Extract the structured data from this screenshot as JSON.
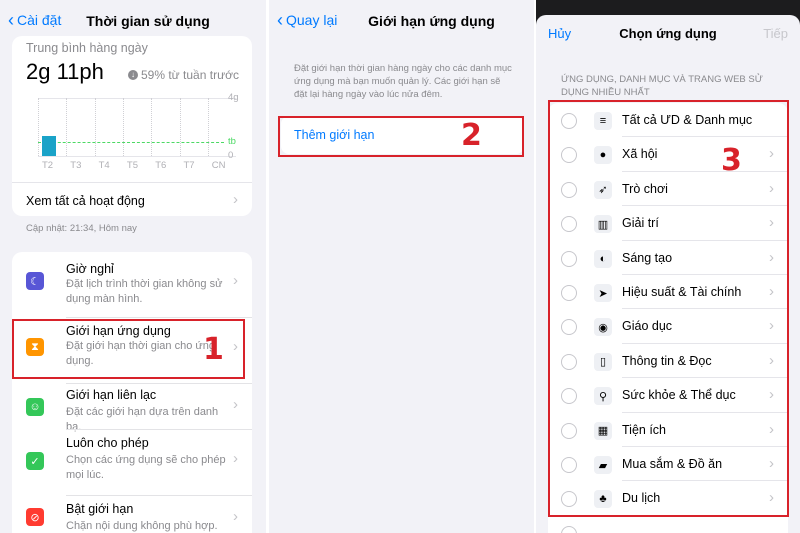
{
  "panel1": {
    "back_label": "Cài đặt",
    "title": "Thời gian sử dụng",
    "daily_avg_label": "Trung bình hàng ngày",
    "daily_avg_value": "2g 11ph",
    "change_label": "59% từ tuần trước",
    "chart_data": {
      "type": "bar",
      "categories": [
        "T2",
        "T3",
        "T4",
        "T5",
        "T6",
        "T7",
        "CN"
      ],
      "values": [
        1.35,
        0,
        0,
        0,
        0,
        0,
        0
      ],
      "average": 0.95,
      "average_label": "tb",
      "ylim": [
        0,
        4
      ],
      "y_ticks": [
        "4g",
        "0"
      ],
      "bar_color": "#1aa3c8",
      "average_color": "#4cd964"
    },
    "see_all_label": "Xem tất cả hoạt động",
    "updated_label": "Cập nhật: 21:34, Hôm nay",
    "items": [
      {
        "title": "Giờ nghỉ",
        "subtitle": "Đặt lịch trình thời gian không sử dụng màn hình.",
        "icon": "moon-icon",
        "color": "#5856d6"
      },
      {
        "title": "Giới hạn ứng dụng",
        "subtitle": "Đặt giới hạn thời gian cho ứng dụng.",
        "icon": "hourglass-icon",
        "color": "#ff9500"
      },
      {
        "title": "Giới hạn liên lạc",
        "subtitle": "Đặt các giới hạn dựa trên danh bạ.",
        "icon": "person-icon",
        "color": "#34c759"
      },
      {
        "title": "Luôn cho phép",
        "subtitle": "Chọn các ứng dụng sẽ cho phép mọi lúc.",
        "icon": "checkmark-icon",
        "color": "#34c759"
      },
      {
        "title": "Bật giới hạn",
        "subtitle": "Chặn nội dung không phù hợp.",
        "icon": "block-icon",
        "color": "#ff3b30"
      }
    ],
    "step": "1"
  },
  "panel2": {
    "back_label": "Quay lại",
    "title": "Giới hạn ứng dụng",
    "description": "Đặt giới hạn thời gian hàng ngày cho các danh mục ứng dụng mà bạn muốn quản lý. Các giới hạn sẽ đặt lại hàng ngày vào lúc nửa đêm.",
    "add_limit_label": "Thêm giới hạn",
    "step": "2"
  },
  "panel3": {
    "cancel_label": "Hủy",
    "title": "Chọn ứng dụng",
    "next_label": "Tiếp",
    "section_header": "ỨNG DỤNG, DANH MỤC VÀ TRANG WEB SỬ DỤNG NHIỀU NHẤT",
    "categories": [
      {
        "label": "Tất cả ƯD & Danh mục",
        "icon": "stack-icon",
        "glyph": "≡",
        "has_chevron": false
      },
      {
        "label": "Xã hội",
        "icon": "chat-bubble-icon",
        "glyph": "●",
        "has_chevron": true
      },
      {
        "label": "Trò chơi",
        "icon": "rocket-icon",
        "glyph": "➶",
        "has_chevron": true
      },
      {
        "label": "Giải trí",
        "icon": "popcorn-icon",
        "glyph": "▥",
        "has_chevron": true
      },
      {
        "label": "Sáng tạo",
        "icon": "palette-icon",
        "glyph": "◐",
        "has_chevron": true
      },
      {
        "label": "Hiệu suất & Tài chính",
        "icon": "paper-plane-icon",
        "glyph": "➤",
        "has_chevron": true
      },
      {
        "label": "Giáo dục",
        "icon": "globe-icon",
        "glyph": "◉",
        "has_chevron": true
      },
      {
        "label": "Thông tin & Đọc",
        "icon": "book-icon",
        "glyph": "▯",
        "has_chevron": true
      },
      {
        "label": "Sức khỏe & Thể dục",
        "icon": "bicycle-icon",
        "glyph": "⚲",
        "has_chevron": true
      },
      {
        "label": "Tiện ích",
        "icon": "calculator-icon",
        "glyph": "▦",
        "has_chevron": true
      },
      {
        "label": "Mua sắm & Đồ ăn",
        "icon": "shopping-bag-icon",
        "glyph": "▰",
        "has_chevron": true
      },
      {
        "label": "Du lịch",
        "icon": "palm-tree-icon",
        "glyph": "♣",
        "has_chevron": true
      }
    ],
    "step": "3"
  }
}
